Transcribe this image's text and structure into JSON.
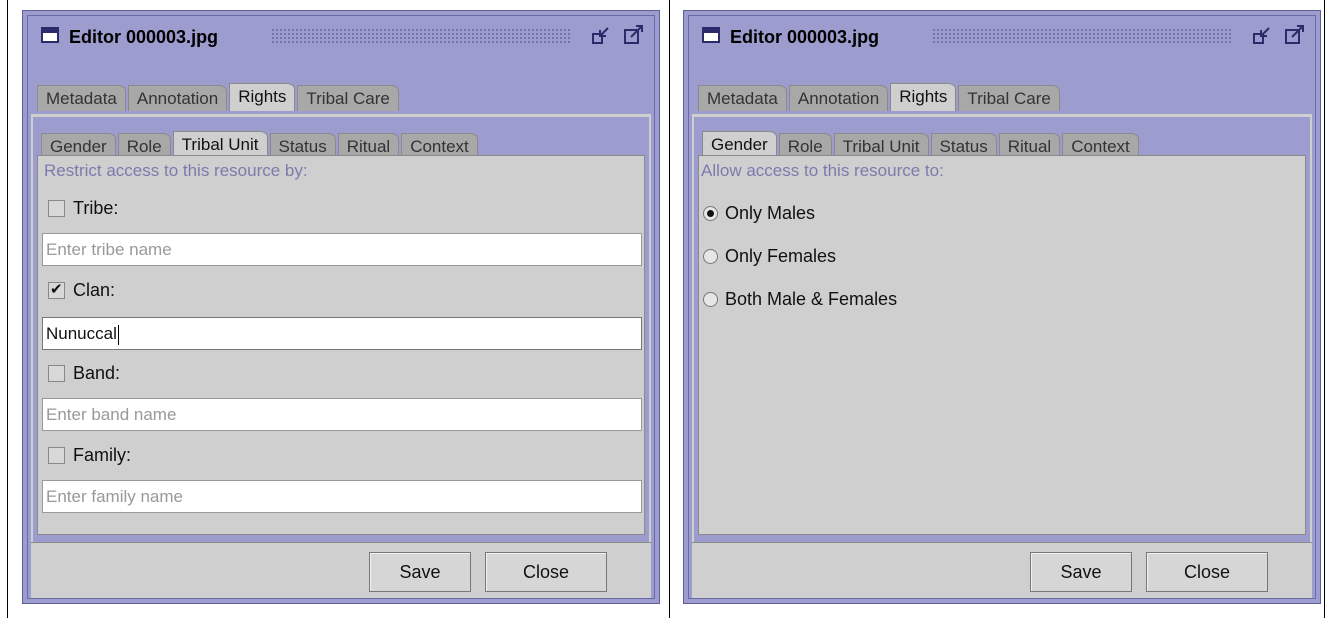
{
  "windows": [
    {
      "title": "Editor 000003.jpg",
      "top_tabs": [
        "Metadata",
        "Annotation",
        "Rights",
        "Tribal Care"
      ],
      "top_active": "Rights",
      "sub_tabs": [
        "Gender",
        "Role",
        "Tribal Unit",
        "Status",
        "Ritual",
        "Context"
      ],
      "sub_active": "Tribal Unit",
      "heading": "Restrict access to this resource by:",
      "fields": [
        {
          "label": "Tribe:",
          "checked": false,
          "value": "",
          "placeholder": "Enter tribe name"
        },
        {
          "label": "Clan:",
          "checked": true,
          "value": "Nunuccal",
          "placeholder": ""
        },
        {
          "label": "Band:",
          "checked": false,
          "value": "",
          "placeholder": "Enter band name"
        },
        {
          "label": "Family:",
          "checked": false,
          "value": "",
          "placeholder": "Enter family name"
        }
      ],
      "save_label": "Save",
      "close_label": "Close"
    },
    {
      "title": "Editor 000003.jpg",
      "top_tabs": [
        "Metadata",
        "Annotation",
        "Rights",
        "Tribal Care"
      ],
      "top_active": "Rights",
      "sub_tabs": [
        "Gender",
        "Role",
        "Tribal Unit",
        "Status",
        "Ritual",
        "Context"
      ],
      "sub_active": "Gender",
      "heading": "Allow access to this resource to:",
      "options": [
        {
          "label": "Only Males",
          "selected": true
        },
        {
          "label": "Only Females",
          "selected": false
        },
        {
          "label": "Both Male & Females",
          "selected": false
        }
      ],
      "save_label": "Save",
      "close_label": "Close"
    }
  ],
  "colors": {
    "window_frame": "#9c9ccf",
    "panel_bg": "#cfcfcf",
    "heading_text": "#7b7bae"
  },
  "icons": [
    "window-icon",
    "minimize-icon",
    "maximize-icon",
    "checkbox",
    "radio-button"
  ]
}
